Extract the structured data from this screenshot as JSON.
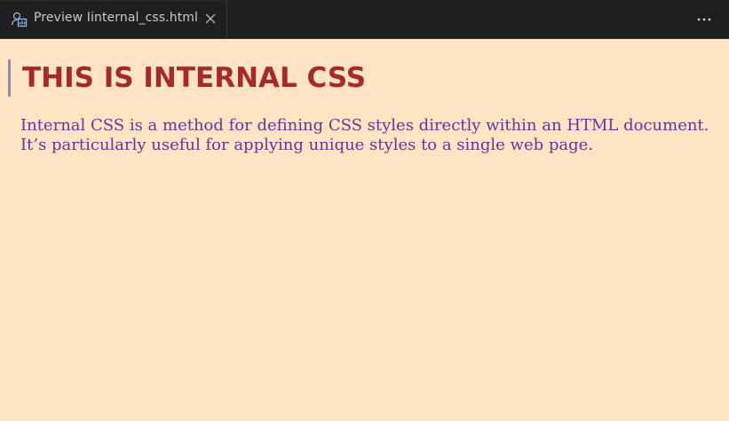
{
  "tab": {
    "label": "Preview Iinternal_css.html",
    "icon": "preview-icon",
    "close_icon": "close-icon"
  },
  "toolbar": {
    "more_icon": "more-actions-icon"
  },
  "page": {
    "heading": "THIS IS INTERNAL CSS",
    "paragraph": "Internal CSS is a method for defining CSS styles directly within an HTML document. It’s particularly useful for applying unique styles to a single web page."
  },
  "colors": {
    "background": "#ffe4c4",
    "heading": "#a52a2a",
    "paragraph": "#663399",
    "heading_border": "#8a8fb0",
    "titlebar": "#1e1e1e"
  }
}
